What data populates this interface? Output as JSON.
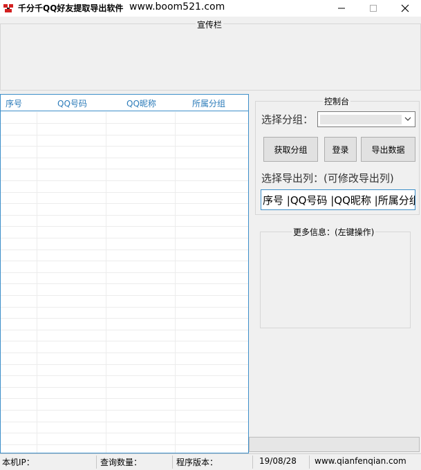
{
  "window": {
    "title": "千分千QQ好友提取导出软件",
    "url": "www.boom521.com",
    "minimize_glyph": "—",
    "maximize_glyph": "☐",
    "close_glyph": "✕",
    "icon": "app-logo-icon",
    "accent_color": "#3c8ec9"
  },
  "promo": {
    "label": "宣传栏"
  },
  "list": {
    "columns": [
      "序号",
      "QQ号码",
      "QQ昵称",
      "所属分组"
    ],
    "rows": []
  },
  "control": {
    "label": "控制台",
    "group_label": "选择分组：",
    "group_select_value": "",
    "buttons": {
      "fetch_groups": "获取分组",
      "login": "登录",
      "export": "导出数据"
    },
    "export_columns_label": "选择导出列：(可修改导出列)",
    "export_columns_value": "序号 |QQ号码 |QQ昵称 |所属分组"
  },
  "more_info": {
    "label": "更多信息：(左键操作)"
  },
  "status": {
    "ip_label": "本机IP：",
    "query_count_label": "查询数量：",
    "version_label": "程序版本：",
    "date": "19/08/28",
    "website": "www.qianfenqian.com"
  }
}
